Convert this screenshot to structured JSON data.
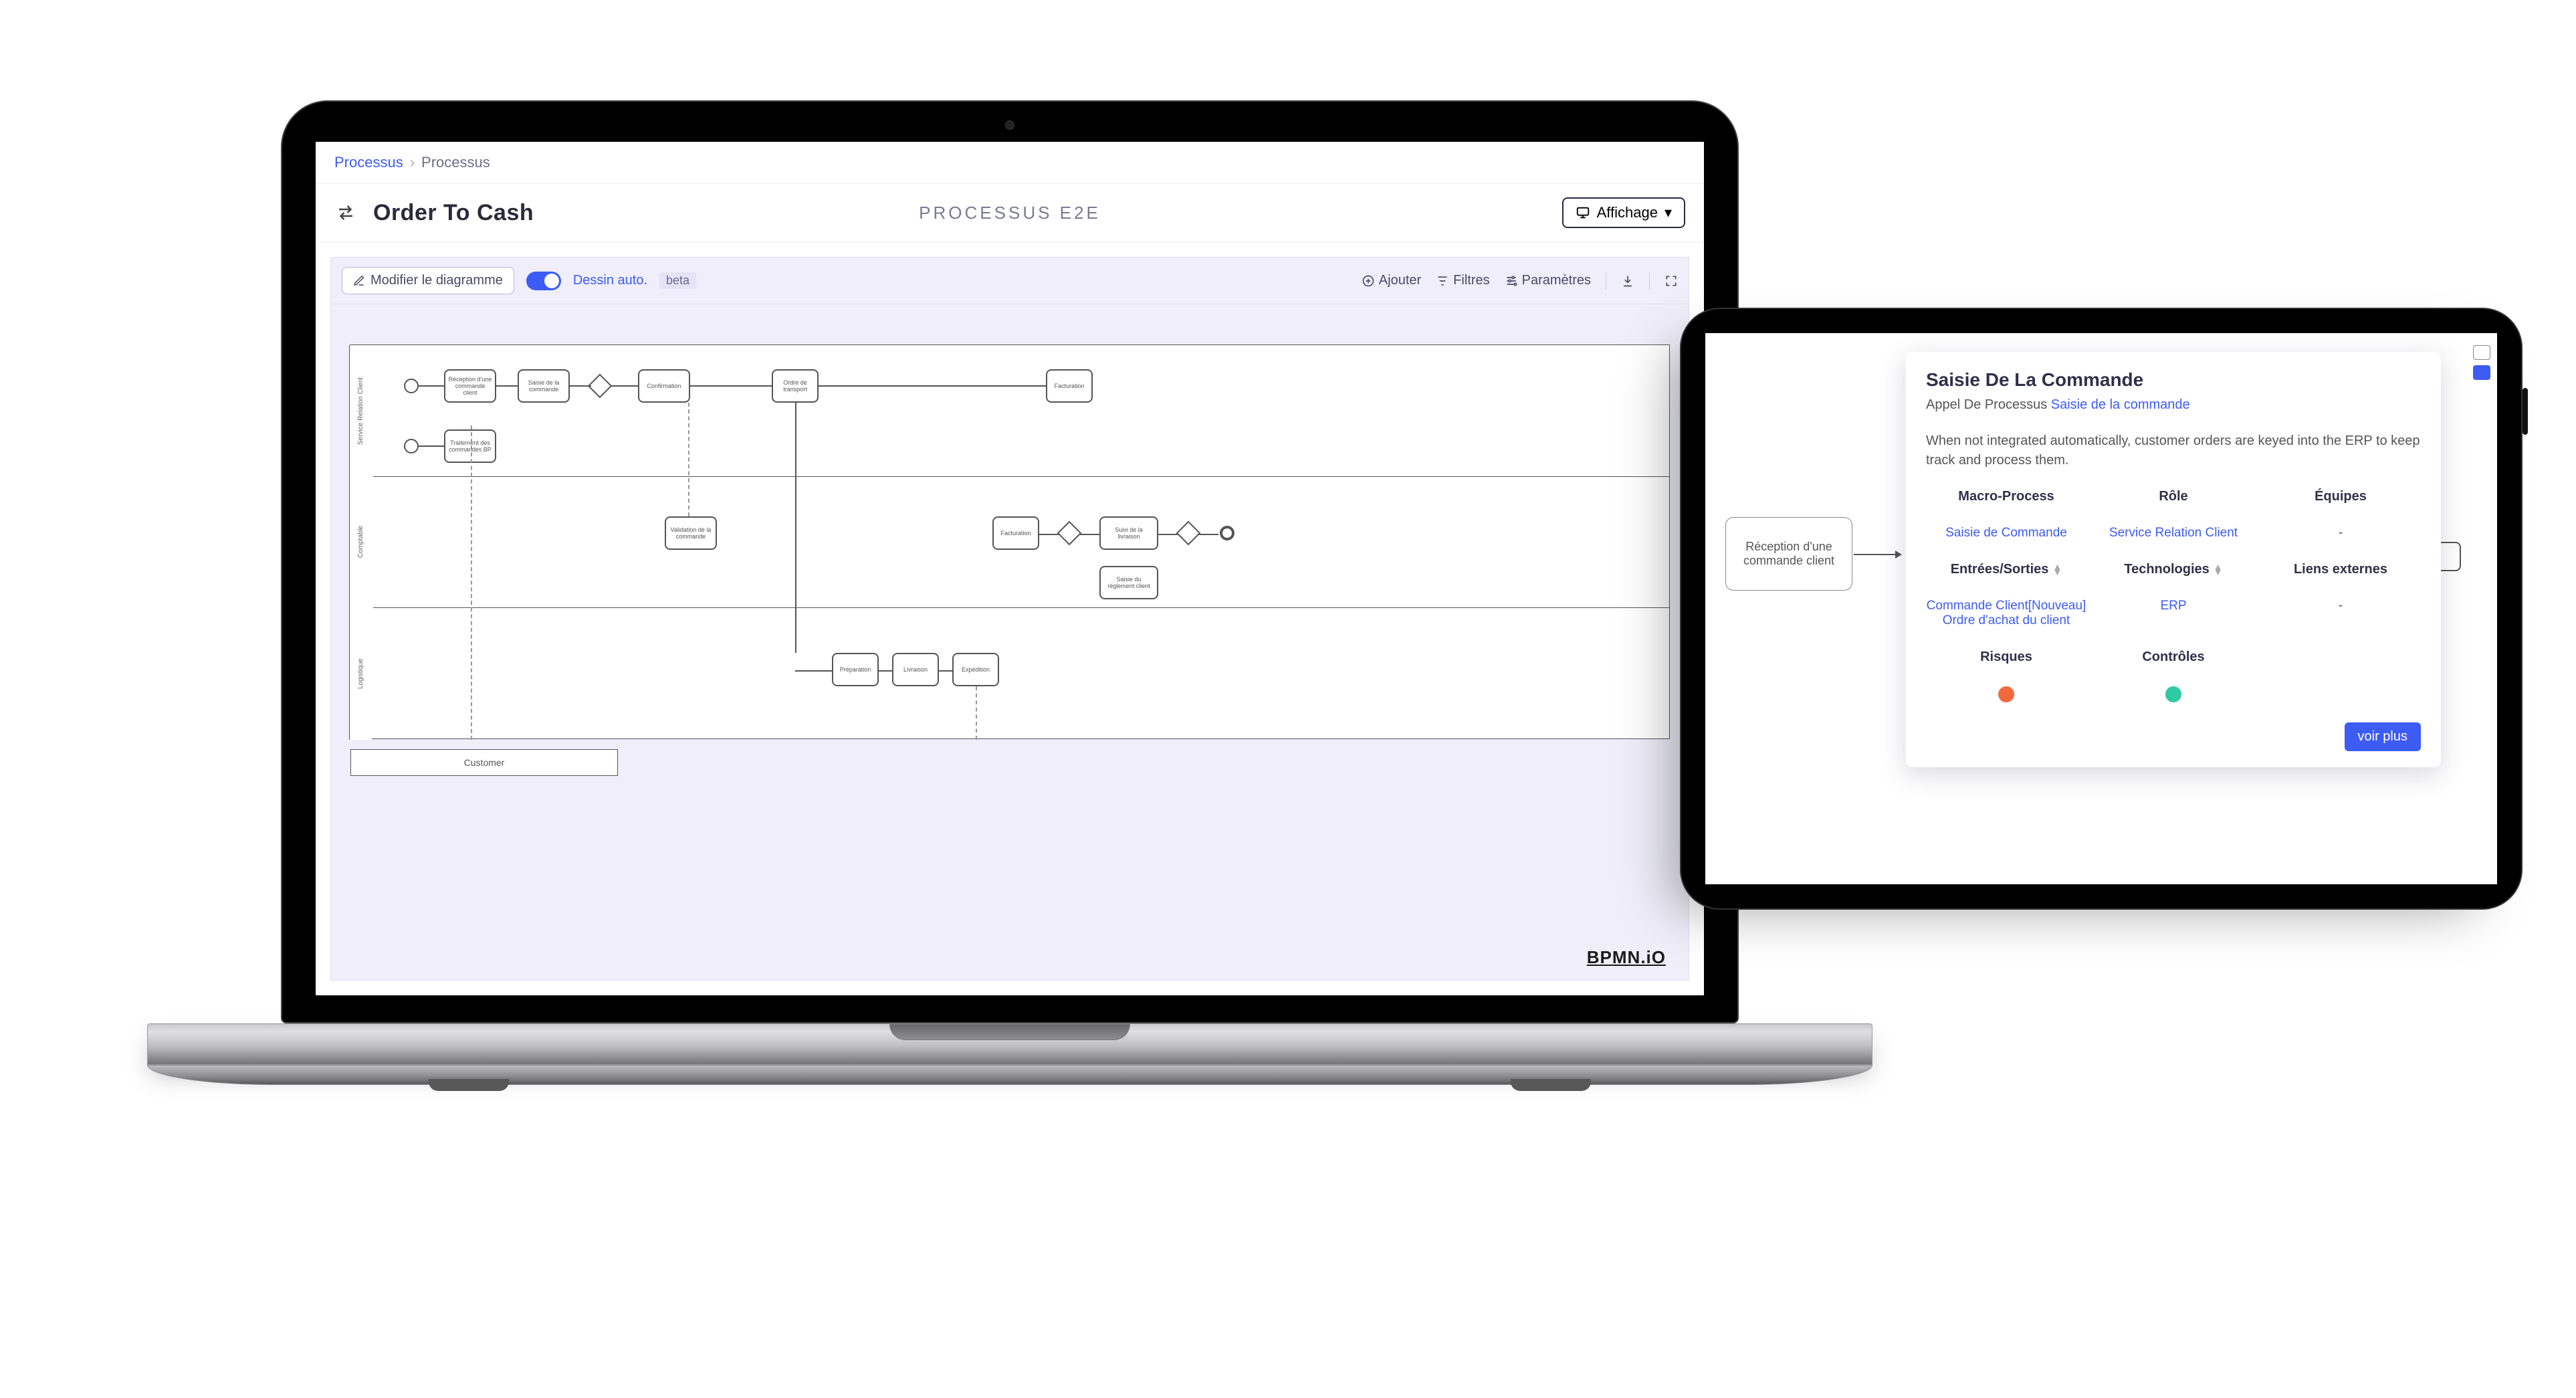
{
  "breadcrumb": {
    "root": "Processus",
    "current": "Processus"
  },
  "header": {
    "title": "Order To Cash",
    "context_label": "PROCESSUS E2E",
    "display_button": "Affichage"
  },
  "canvas_toolbar": {
    "edit_diagram": "Modifier le diagramme",
    "auto_draw": "Dessin auto.",
    "beta_badge": "beta",
    "add": "Ajouter",
    "filters": "Filtres",
    "settings": "Paramètres"
  },
  "diagram": {
    "lanes": [
      "Service Relation Client",
      "Comptable",
      "Logistique"
    ],
    "external_pool": "Customer",
    "tasks": {
      "reception": "Réception d'une commande client",
      "saisie": "Saisie de la commande",
      "traitement": "Traitement des commandes BP",
      "confirmation": "Confirmation",
      "ordre_transport": "Ordre de transport",
      "facturation": "Facturation",
      "validation": "Validation de la commande",
      "suivi_livr": "Suivi de la livraison",
      "saisie_reg": "Saisie du règlement client",
      "preparation": "Préparation",
      "livraison": "Livraison",
      "expedition": "Expédition"
    },
    "watermark": "BPMN.iO"
  },
  "tablet": {
    "mini_card": "Réception d'une commande client",
    "panel": {
      "title": "Saisie De La Commande",
      "subtitle_prefix": "Appel De Processus",
      "subtitle_link": "Saisie de la commande",
      "description": "When not integrated automatically, customer orders are keyed into the ERP to keep track and process them.",
      "cols": {
        "macro_process": {
          "label": "Macro-Process",
          "value": "Saisie de Commande"
        },
        "role": {
          "label": "Rôle",
          "value": "Service Relation Client"
        },
        "teams": {
          "label": "Équipes",
          "value": "-"
        },
        "io": {
          "label": "Entrées/Sorties",
          "values": [
            "Commande Client[Nouveau]",
            "Ordre d'achat du client"
          ]
        },
        "tech": {
          "label": "Technologies",
          "value": "ERP"
        },
        "links": {
          "label": "Liens externes",
          "value": "-"
        },
        "risks": {
          "label": "Risques",
          "count": 1,
          "color": "#f2693c"
        },
        "controls": {
          "label": "Contrôles",
          "count": 1,
          "color": "#2fc9a3"
        }
      },
      "see_more": "voir plus"
    }
  }
}
